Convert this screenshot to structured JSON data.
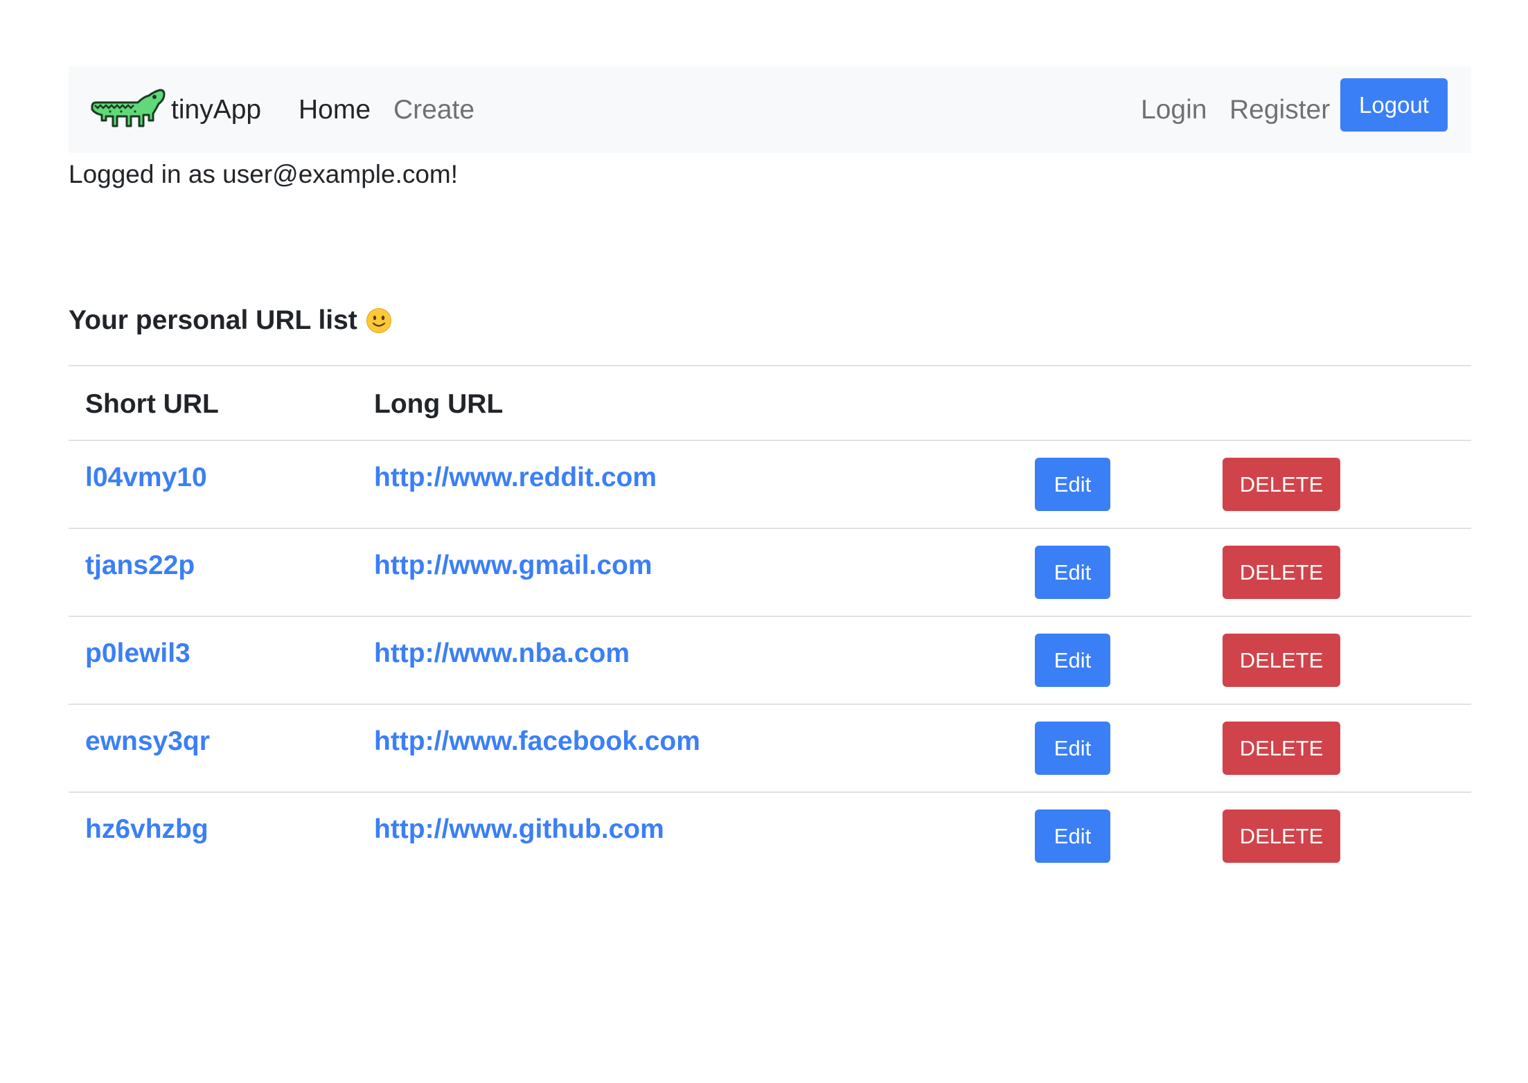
{
  "navbar": {
    "brand_text": "tinyApp",
    "brand_icon": "crocodile-logo",
    "links": {
      "home": "Home",
      "create": "Create",
      "login": "Login",
      "register": "Register"
    },
    "logout_label": "Logout"
  },
  "status": {
    "logged_in_text": "Logged in as user@example.com!"
  },
  "main": {
    "heading": "Your personal URL list",
    "heading_icon": "smiley-emoji-icon",
    "table": {
      "headers": {
        "short_url": "Short URL",
        "long_url": "Long URL"
      },
      "rows": [
        {
          "short": "l04vmy10",
          "long": "http://www.reddit.com",
          "edit": "Edit",
          "delete": "DELETE"
        },
        {
          "short": "tjans22p",
          "long": "http://www.gmail.com",
          "edit": "Edit",
          "delete": "DELETE"
        },
        {
          "short": "p0lewil3",
          "long": "http://www.nba.com",
          "edit": "Edit",
          "delete": "DELETE"
        },
        {
          "short": "ewnsy3qr",
          "long": "http://www.facebook.com",
          "edit": "Edit",
          "delete": "DELETE"
        },
        {
          "short": "hz6vhzbg",
          "long": "http://www.github.com",
          "edit": "Edit",
          "delete": "DELETE"
        }
      ]
    }
  },
  "colors": {
    "primary": "#3a7ff6",
    "danger": "#d1434b",
    "navbar_bg": "#f8f9fa",
    "logo_green": "#5fd97a"
  }
}
